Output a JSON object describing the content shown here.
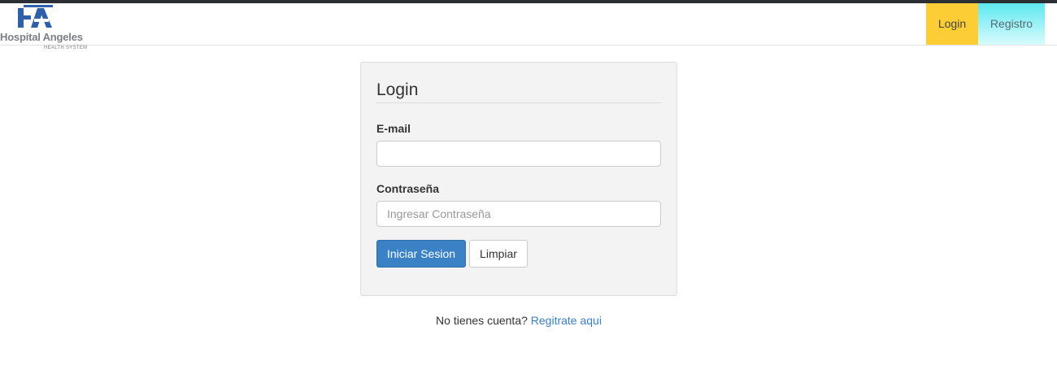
{
  "brand": {
    "name": "Hospital Angeles",
    "subtitle": "HEALTH SYSTEM",
    "colors": {
      "logo_blue": "#2f5fa8",
      "logo_gray": "#7d7f85"
    }
  },
  "nav": {
    "login_label": "Login",
    "registro_label": "Registro",
    "colors": {
      "login_bg": "#fdcd35",
      "registro_bg": "#5ee8f0"
    }
  },
  "form": {
    "title": "Login",
    "email_label": "E-mail",
    "email_value": "",
    "email_placeholder": "",
    "password_label": "Contraseña",
    "password_value": "",
    "password_placeholder": "Ingresar Contraseña",
    "submit_label": "Iniciar Sesion",
    "clear_label": "Limpiar",
    "colors": {
      "primary": "#3a82c5"
    }
  },
  "footer": {
    "prompt": "No tienes cuenta?",
    "link_label": "Regitrate aqui",
    "colors": {
      "link": "#3a7fc1"
    }
  }
}
